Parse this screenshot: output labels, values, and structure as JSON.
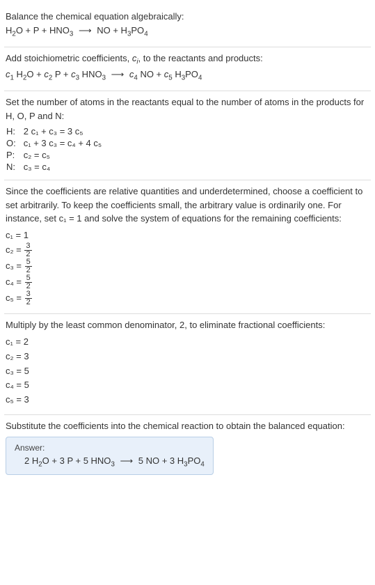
{
  "sec1": {
    "title": "Balance the chemical equation algebraically:",
    "r1": "H",
    "r1s": "2",
    "r1b": "O + P + HNO",
    "r1s2": "3",
    "arrow": "⟶",
    "p1": "NO + H",
    "p1s": "3",
    "p1b": "PO",
    "p1s2": "4"
  },
  "sec2": {
    "linea": "Add stoichiometric coefficients, ",
    "ci": "c",
    "cis": "i",
    "lineb": ", to the reactants and products:",
    "c1": "c",
    "c1s": "1",
    "r1a": " H",
    "r1as": "2",
    "r1ab": "O + ",
    "c2": "c",
    "c2s": "2",
    "r2": " P + ",
    "c3": "c",
    "c3s": "3",
    "r3a": " HNO",
    "r3as": "3",
    "arrow": "⟶",
    "c4": "c",
    "c4s": "4",
    "p1": " NO + ",
    "c5": "c",
    "c5s": "5",
    "p2a": " H",
    "p2as": "3",
    "p2b": "PO",
    "p2bs": "4"
  },
  "sec3": {
    "line1": "Set the number of atoms in the reactants equal to the number of atoms in the products for H, O, P and N:",
    "rows": [
      {
        "label": "H:",
        "lhs": "2 c₁ + c₃",
        "rhs": "3 c₅"
      },
      {
        "label": "O:",
        "lhs": "c₁ + 3 c₃",
        "rhs": "c₄ + 4 c₅"
      },
      {
        "label": "P:",
        "lhs": "c₂",
        "rhs": "c₅"
      },
      {
        "label": "N:",
        "lhs": "c₃",
        "rhs": "c₄"
      }
    ],
    "eq": " = "
  },
  "sec4": {
    "text": "Since the coefficients are relative quantities and underdetermined, choose a coefficient to set arbitrarily. To keep the coefficients small, the arbitrary value is ordinarily one. For instance, set c₁ = 1 and solve the system of equations for the remaining coefficients:",
    "c1": "c₁ = 1",
    "c2a": "c₂ = ",
    "c2n": "3",
    "c2d": "2",
    "c3a": "c₃ = ",
    "c3n": "5",
    "c3d": "2",
    "c4a": "c₄ = ",
    "c4n": "5",
    "c4d": "2",
    "c5a": "c₅ = ",
    "c5n": "3",
    "c5d": "2"
  },
  "sec5": {
    "text": "Multiply by the least common denominator, 2, to eliminate fractional coefficients:",
    "c1": "c₁ = 2",
    "c2": "c₂ = 3",
    "c3": "c₃ = 5",
    "c4": "c₄ = 5",
    "c5": "c₅ = 3"
  },
  "sec6": {
    "text": "Substitute the coefficients into the chemical reaction to obtain the balanced equation:",
    "answerTitle": "Answer:",
    "eqL1": "2 H",
    "eqL1s": "2",
    "eqL2": "O + 3 P + 5 HNO",
    "eqL2s": "3",
    "arrow": "⟶",
    "eqR1": "5 NO + 3 H",
    "eqR1s": "3",
    "eqR2": "PO",
    "eqR2s": "4"
  }
}
